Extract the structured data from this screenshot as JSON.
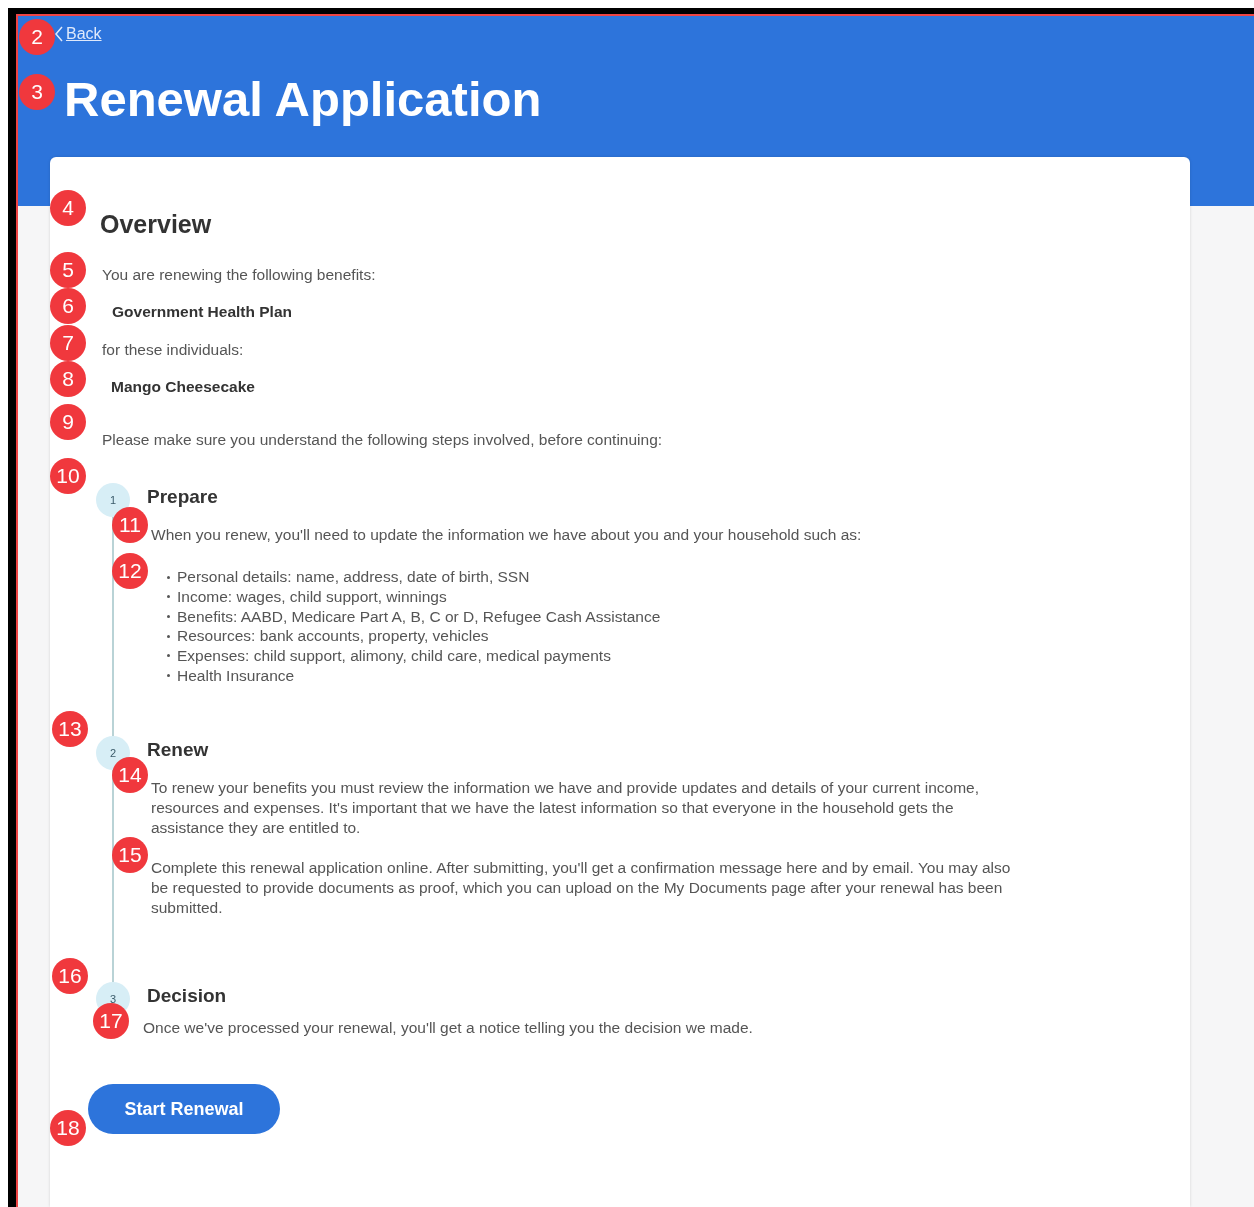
{
  "back_link": "Back",
  "title": "Renewal Application",
  "overview": {
    "heading": "Overview",
    "intro": "You are renewing the following benefits:",
    "benefits": [
      "Government Health Plan"
    ],
    "individuals_label": "for these individuals:",
    "individuals": [
      "Mango Cheesecake"
    ],
    "steps_intro": "Please make sure you understand the following steps involved, before continuing:"
  },
  "steps": [
    {
      "number": "1",
      "title": "Prepare",
      "paragraphs": [
        "When you renew, you'll need to update the information we have about you and your household such as:"
      ],
      "bullets": [
        "Personal details: name, address, date of birth, SSN",
        "Income: wages, child support, winnings",
        "Benefits: AABD, Medicare Part A, B, C or D, Refugee Cash Assistance",
        "Resources: bank accounts, property, vehicles",
        "Expenses: child support, alimony, child care, medical payments",
        "Health Insurance"
      ]
    },
    {
      "number": "2",
      "title": "Renew",
      "paragraphs": [
        "To renew your benefits you must review the information we have and provide updates and details of your current income, resources and expenses. It's important that we have the latest information so that everyone in the household gets the assistance they are entitled to.",
        "Complete this renewal application online. After submitting, you'll get a confirmation message here and by email. You may also be requested to provide documents as proof, which you can upload on the My Documents page after your renewal has been submitted."
      ]
    },
    {
      "number": "3",
      "title": "Decision",
      "paragraphs": [
        "Once we've processed your renewal, you'll get a notice telling you the decision we made."
      ]
    }
  ],
  "start_button": "Start Renewal",
  "annotation_markers": [
    "2",
    "3",
    "4",
    "5",
    "6",
    "7",
    "8",
    "9",
    "10",
    "11",
    "12",
    "13",
    "14",
    "15",
    "16",
    "17",
    "18"
  ]
}
